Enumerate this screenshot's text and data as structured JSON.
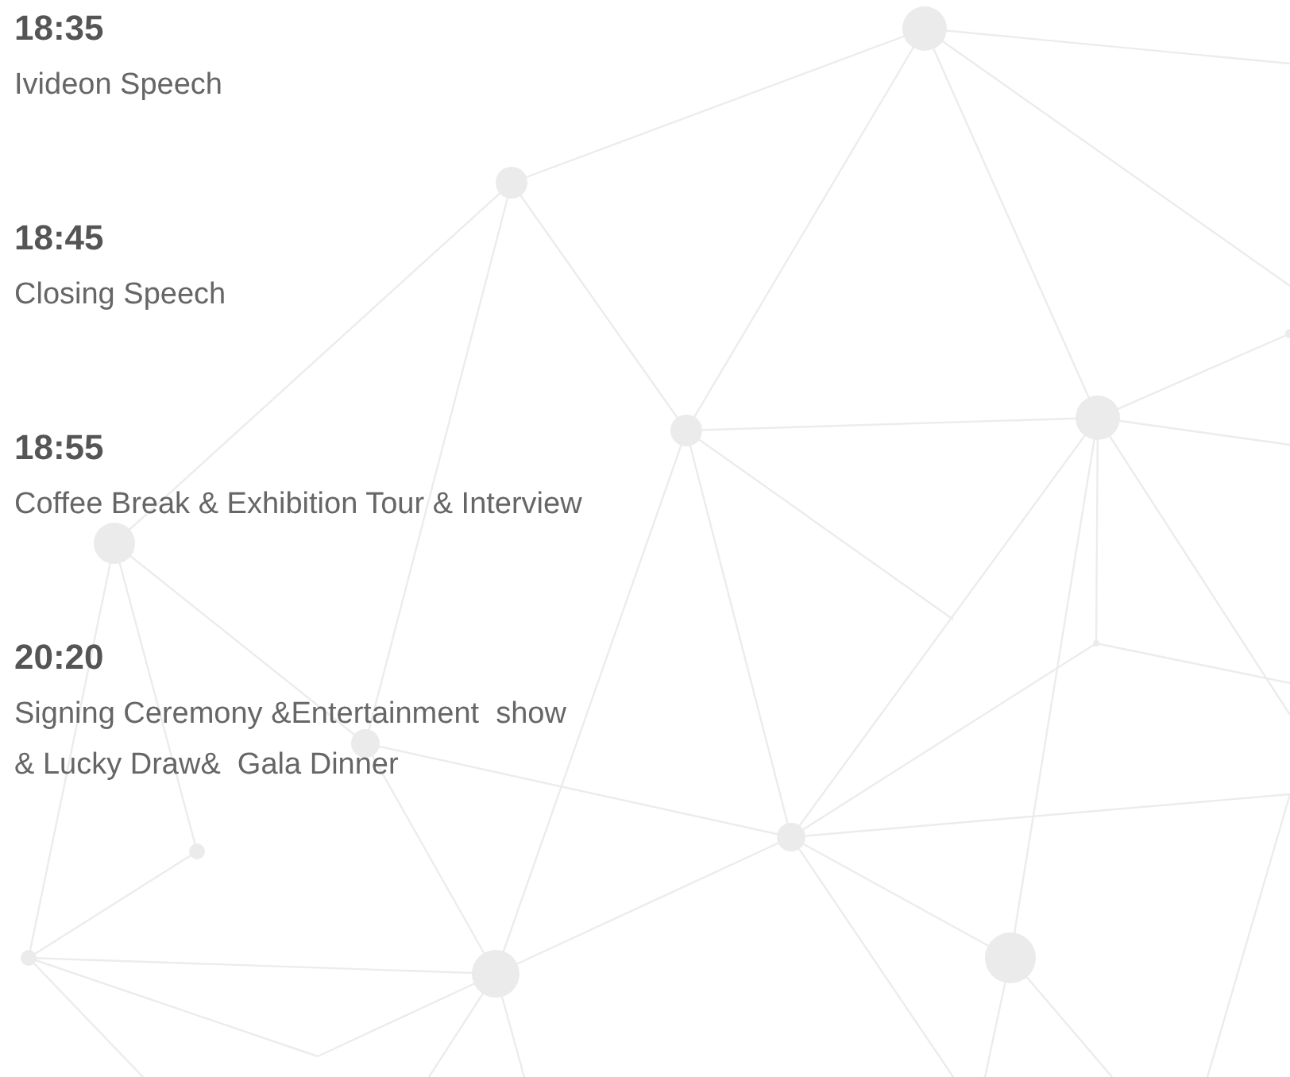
{
  "agenda": [
    {
      "time": "18:35",
      "title": "Ivideon Speech"
    },
    {
      "time": "18:45",
      "title": "Closing Speech"
    },
    {
      "time": "18:55",
      "title": "Coffee Break & Exhibition Tour & Interview"
    },
    {
      "time": "20:20",
      "title": "Signing Ceremony &Entertainment  show\n& Lucky Draw&  Gala Dinner"
    }
  ]
}
